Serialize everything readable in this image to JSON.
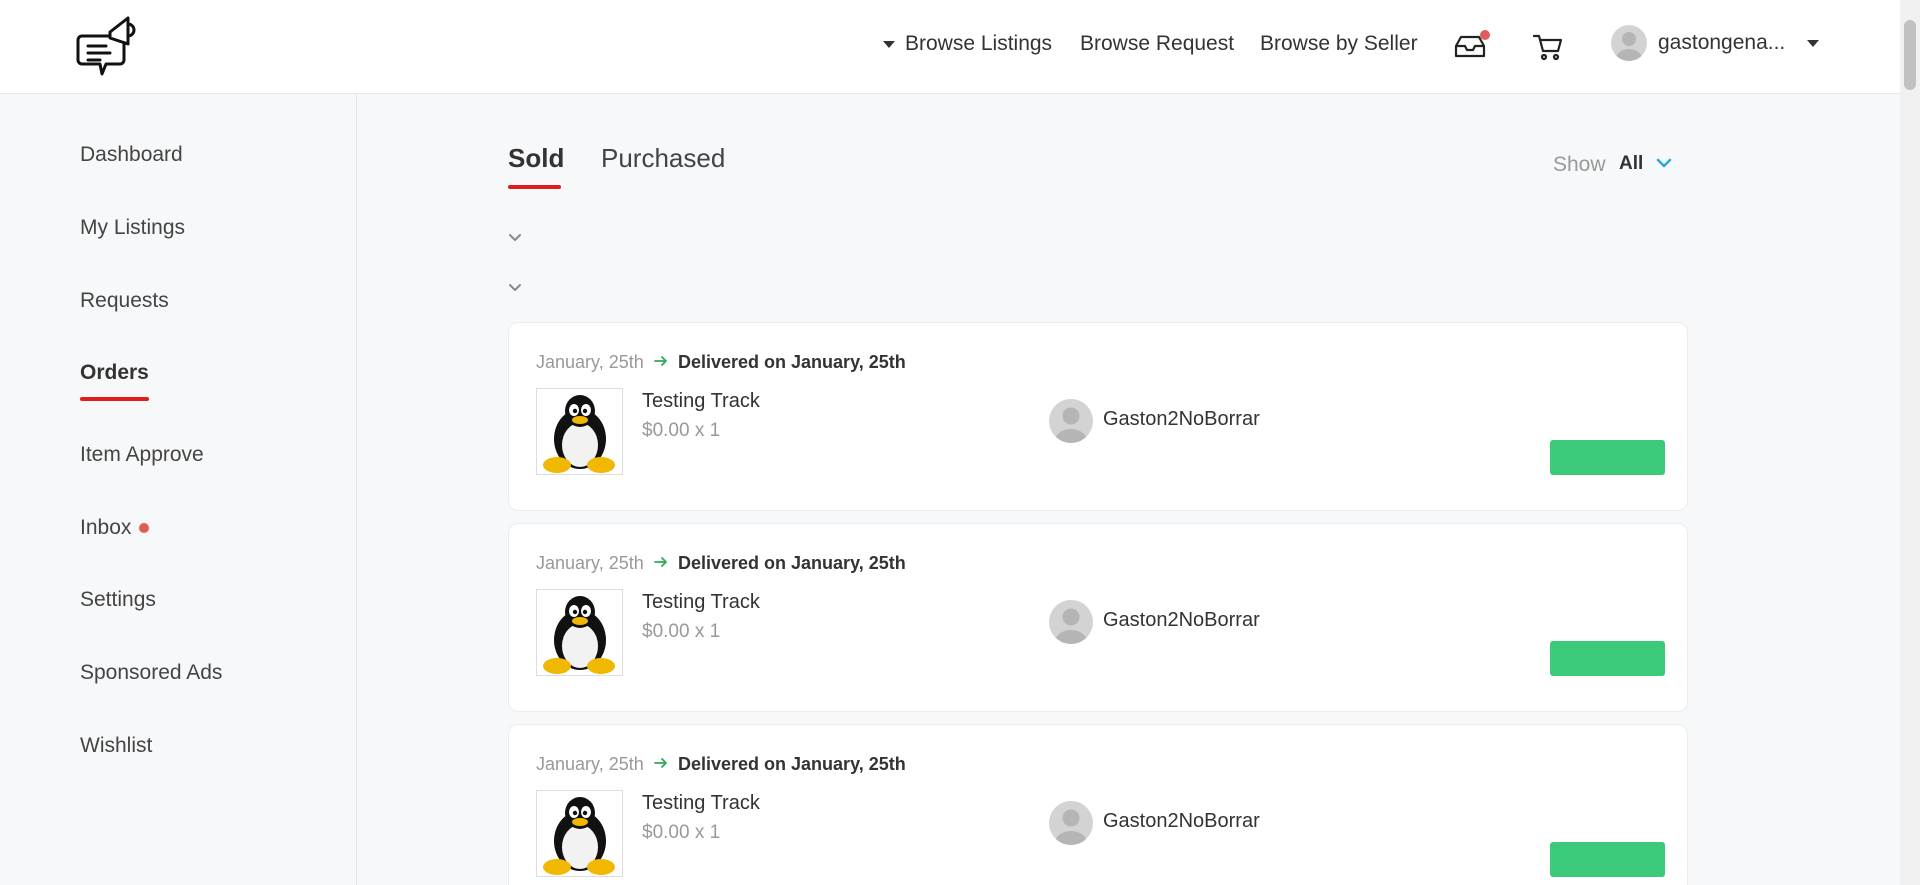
{
  "header": {
    "nav": {
      "browse_listings": "Browse Listings",
      "browse_request": "Browse Request",
      "browse_by_seller": "Browse by Seller"
    },
    "username": "gastongena..."
  },
  "sidebar": {
    "items": [
      {
        "label": "Dashboard"
      },
      {
        "label": "My Listings"
      },
      {
        "label": "Requests"
      },
      {
        "label": "Orders"
      },
      {
        "label": "Item Approve"
      },
      {
        "label": "Inbox"
      },
      {
        "label": "Settings"
      },
      {
        "label": "Sponsored Ads"
      },
      {
        "label": "Wishlist"
      }
    ],
    "active": "Orders"
  },
  "main": {
    "tabs": [
      {
        "label": "Sold"
      },
      {
        "label": "Purchased"
      }
    ],
    "active_tab": "Sold",
    "show_label": "Show",
    "show_value": "All",
    "orders": [
      {
        "date": "January, 25th",
        "status": "Delivered on January, 25th",
        "title": "Testing Track",
        "price": "$0.00 x 1",
        "buyer": "Gaston2NoBorrar"
      },
      {
        "date": "January, 25th",
        "status": "Delivered on January, 25th",
        "title": "Testing Track",
        "price": "$0.00 x 1",
        "buyer": "Gaston2NoBorrar"
      },
      {
        "date": "January, 25th",
        "status": "Delivered on January, 25th",
        "title": "Testing Track",
        "price": "$0.00 x 1",
        "buyer": "Gaston2NoBorrar"
      }
    ]
  },
  "colors": {
    "accent_red": "#e01e1e",
    "notification_dot": "#e05c5c",
    "action_green": "#3cc97a",
    "link_blue": "#29a8e0"
  },
  "icons": {
    "logo": "megaphone-chat-icon",
    "inbox": "inbox-tray-icon",
    "cart": "shopping-cart-icon",
    "avatar": "user-avatar-icon",
    "status_arrow": "arrow-right-icon",
    "product_thumb": "penguin-image"
  }
}
